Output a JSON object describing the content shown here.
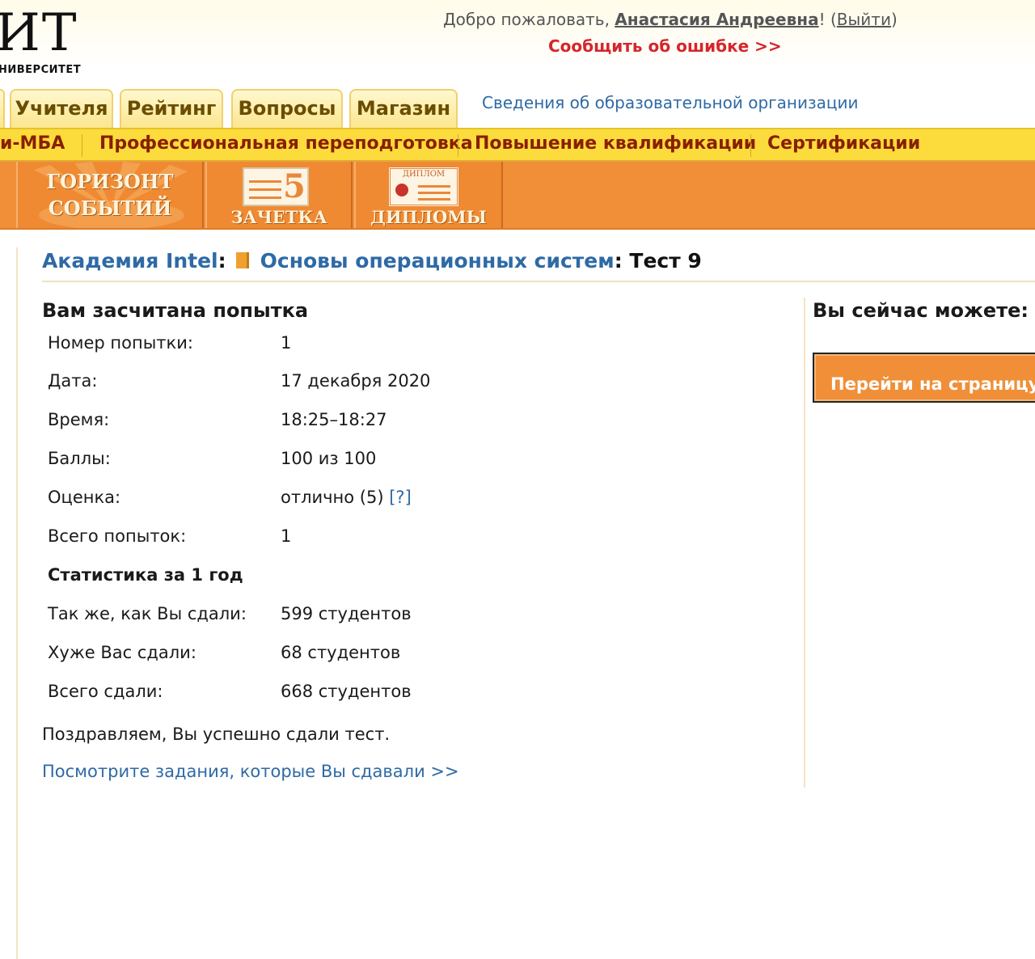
{
  "header": {
    "logo_text": "ИТ",
    "logo_subtitle": "НИВЕРСИТЕТ",
    "welcome_prefix": "Добро пожаловать, ",
    "user_name": "Анастасия Андреевна",
    "welcome_exclaim": "!",
    "logout_open": " (",
    "logout_label": "Выйти",
    "logout_close": ")",
    "report_error": "Сообщить об ошибке >>"
  },
  "tabs": [
    {
      "label": "Учителя"
    },
    {
      "label": "Рейтинг"
    },
    {
      "label": "Вопросы"
    },
    {
      "label": "Магазин"
    }
  ],
  "org_info_link": "Сведения об образовательной организации",
  "yellow_nav": [
    {
      "label": "и-МБА"
    },
    {
      "label": "Профессиональная переподготовка"
    },
    {
      "label": "Повышение квалификации"
    },
    {
      "label": "Сертификации"
    }
  ],
  "banners": {
    "horizon_line1": "ГОРИЗОНТ",
    "horizon_line2": "СОБЫТИЙ",
    "zachetka_grade": "5",
    "zachetka_label": "ЗАЧЕТКА",
    "diploma_badge": "ДИПЛОМ",
    "diplomas_label": "ДИПЛОМЫ"
  },
  "breadcrumb": {
    "academy": "Академия Intel",
    "sep1": ":",
    "course": "Основы операционных систем",
    "sep2": ": ",
    "test": "Тест 9"
  },
  "attempt": {
    "heading": "Вам засчитана попытка",
    "rows": [
      {
        "label": "Номер попытки:",
        "value": "1"
      },
      {
        "label": "Дата:",
        "value": "17 декабря 2020"
      },
      {
        "label": "Время:",
        "value": "18:25–18:27"
      },
      {
        "label": "Баллы:",
        "value": "100 из 100"
      },
      {
        "label": "Оценка:",
        "value": "отлично (5) ",
        "help": "[?]"
      },
      {
        "label": "Всего попыток:",
        "value": "1"
      }
    ],
    "stats_heading": "Статистика за 1 год",
    "stats": [
      {
        "label": "Так же, как Вы сдали:",
        "value": "599 студентов"
      },
      {
        "label": "Хуже Вас сдали:",
        "value": "68 студентов"
      },
      {
        "label": "Всего сдали:",
        "value": "668 студентов"
      }
    ],
    "congrats": "Поздравляем, Вы успешно сдали тест.",
    "view_tasks_link": "Посмотрите задания, которые Вы сдавали >>"
  },
  "sidebar": {
    "heading": "Вы сейчас можете:",
    "button_label": "Перейти на страницу"
  },
  "colors": {
    "link_blue": "#2e6aa5",
    "error_red": "#d6252b",
    "nav_yellow": "#fcdc3c",
    "banner_orange": "#f08f38"
  }
}
